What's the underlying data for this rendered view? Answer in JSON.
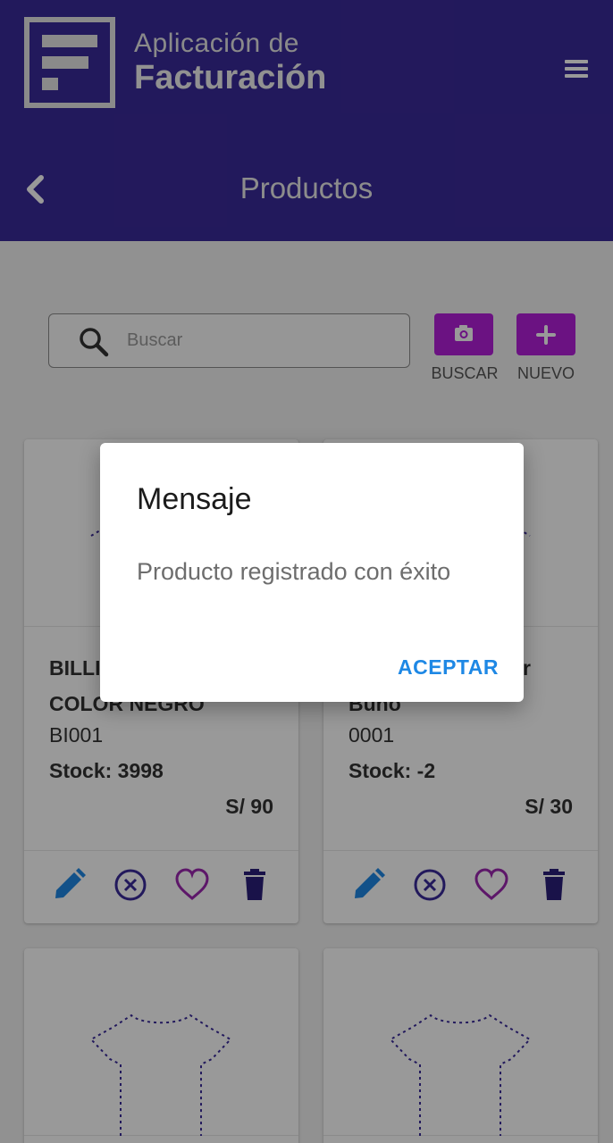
{
  "header": {
    "brand_line1": "Aplicación de",
    "brand_line2": "Facturación",
    "page_title": "Productos"
  },
  "toolbar": {
    "search_placeholder": "Buscar",
    "scan_label": "BUSCAR",
    "new_label": "NUEVO"
  },
  "products": [
    {
      "name_lines": [
        "BILLI",
        "COLOR NEGRO"
      ],
      "code": "BI001",
      "stock": "Stock: 3998",
      "price": "S/ 90"
    },
    {
      "name_lines": [
        "r",
        "Buho"
      ],
      "code": "0001",
      "stock": "Stock: -2",
      "price": "S/ 30"
    }
  ],
  "dialog": {
    "title": "Mensaje",
    "message": "Producto registrado con éxito",
    "ok_label": "ACEPTAR"
  },
  "colors": {
    "header_bg": "#3a2a9a",
    "action_button": "#b21ed9",
    "edit_icon": "#1e88e5",
    "cancel_icon": "#3a2a9a",
    "favorite_icon": "#9c27b0",
    "delete_icon": "#2a1f7a",
    "dialog_button": "#1e88e5"
  },
  "icons": {
    "menu": "hamburger-menu-icon",
    "back": "chevron-left-icon",
    "search": "search-icon",
    "scan": "camera-icon",
    "new": "plus-icon",
    "edit": "pencil-icon",
    "cancel": "x-circle-icon",
    "favorite": "heart-outline-icon",
    "delete": "trash-icon"
  }
}
